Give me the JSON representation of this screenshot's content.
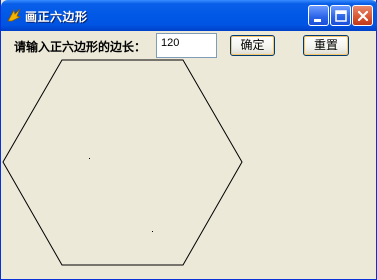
{
  "window": {
    "title": "画正六边形"
  },
  "form": {
    "side_label": "请输入正六边形的边长：",
    "side_value": "120",
    "ok_label": "确定",
    "reset_label": "重置"
  },
  "colors": {
    "titlebar": "#0054E3",
    "window_bg": "#ECE9D8",
    "close_button": "#D9542F"
  }
}
